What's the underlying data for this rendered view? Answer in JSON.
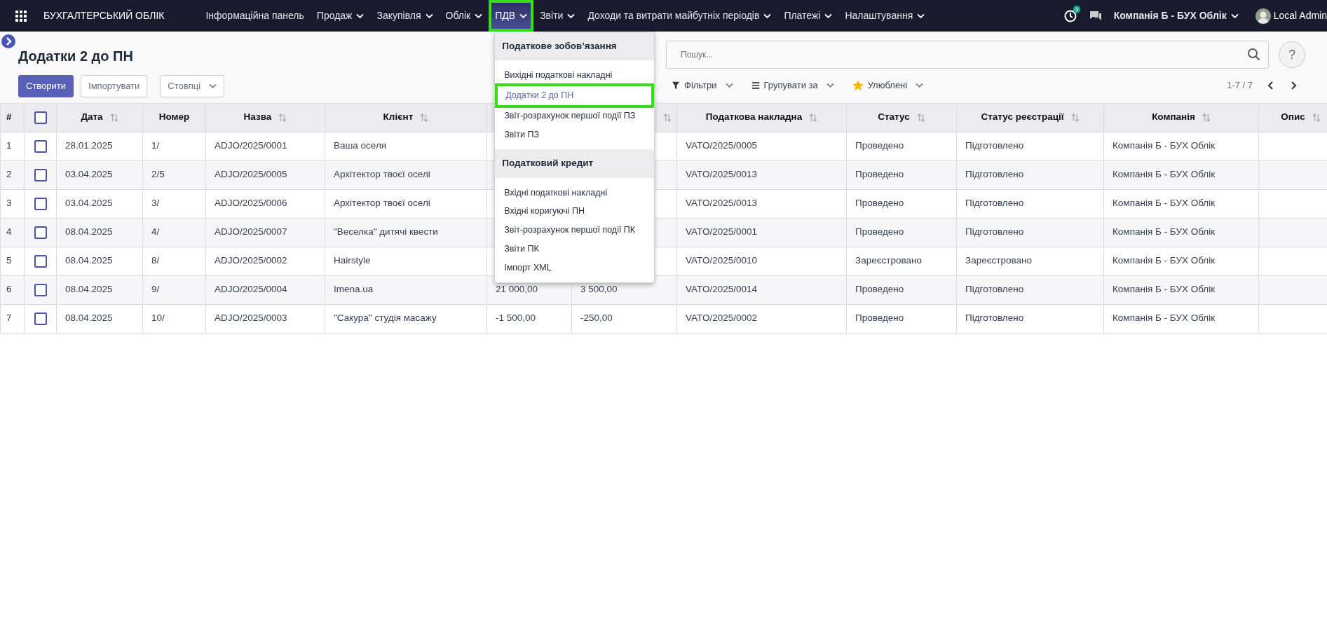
{
  "app_title": "БУХГАЛТЕРСЬКИЙ ОБЛІК",
  "nav": [
    {
      "label": "Інформаційна панель",
      "dropdown": false,
      "selected": false,
      "highlighted": false
    },
    {
      "label": "Продаж",
      "dropdown": true,
      "selected": false,
      "highlighted": false
    },
    {
      "label": "Закупівля",
      "dropdown": true,
      "selected": false,
      "highlighted": false
    },
    {
      "label": "Облік",
      "dropdown": true,
      "selected": false,
      "highlighted": false
    },
    {
      "label": "ПДВ",
      "dropdown": true,
      "selected": true,
      "highlighted": true
    },
    {
      "label": "Звіти",
      "dropdown": true,
      "selected": false,
      "highlighted": false
    },
    {
      "label": "Доходи та витрати майбутніх періодів",
      "dropdown": true,
      "selected": false,
      "highlighted": false
    },
    {
      "label": "Платежі",
      "dropdown": true,
      "selected": false,
      "highlighted": false
    },
    {
      "label": "Налаштування",
      "dropdown": true,
      "selected": false,
      "highlighted": false
    }
  ],
  "activity_count": "3",
  "company": "Компанія Б - БУХ Облік",
  "user": "Local Admin",
  "open_menu": {
    "sections": [
      {
        "title": "Податкове зобов'язання",
        "items": [
          {
            "label": "Вихідні податкові накладні",
            "selected": false,
            "highlighted": false
          },
          {
            "label": "Додатки 2 до ПН",
            "selected": true,
            "highlighted": true
          },
          {
            "label": "Звіт-розрахунок першої події ПЗ",
            "selected": false,
            "highlighted": false
          },
          {
            "label": "Звіти ПЗ",
            "selected": false,
            "highlighted": false
          }
        ]
      },
      {
        "title": "Податковий кредит",
        "items": [
          {
            "label": "Вхідні податкові накладні",
            "selected": false,
            "highlighted": false
          },
          {
            "label": "Вхідні коригуючі ПН",
            "selected": false,
            "highlighted": false
          },
          {
            "label": "Звіт-розрахунок першої події ПК",
            "selected": false,
            "highlighted": false
          },
          {
            "label": "Звіти ПК",
            "selected": false,
            "highlighted": false
          },
          {
            "label": "Імпорт XML",
            "selected": false,
            "highlighted": false
          }
        ]
      }
    ]
  },
  "page_title": "Додатки 2 до ПН",
  "buttons": {
    "create": "Створити",
    "import": "Імпортувати",
    "columns": "Стовпці"
  },
  "search": {
    "placeholder": "Пошук..."
  },
  "help": "?",
  "filters": [
    "Фільтри",
    "Групувати за",
    "Улюблені"
  ],
  "pager": "1-7 / 7",
  "table": {
    "all_selected": false,
    "columns": [
      {
        "kind": "text",
        "label": "#",
        "sortable": false
      },
      {
        "kind": "checkbox"
      },
      {
        "kind": "text",
        "label": "Дата",
        "sortable": true
      },
      {
        "kind": "text",
        "label": "Номер",
        "sortable": false
      },
      {
        "kind": "text",
        "label": "Назва",
        "sortable": true
      },
      {
        "kind": "text",
        "label": "Клієнт",
        "sortable": true
      },
      {
        "kind": "text",
        "sortable": false
      },
      {
        "kind": "text",
        "sortable": true
      },
      {
        "kind": "text",
        "label": "Податкова накладна",
        "sortable": true
      },
      {
        "kind": "text",
        "label": "Статус",
        "sortable": true
      },
      {
        "kind": "text",
        "label": "Статус реєстрації",
        "sortable": true
      },
      {
        "kind": "text",
        "label": "Компанія",
        "sortable": true
      },
      {
        "kind": "text",
        "label": "Опис",
        "sortable": true
      }
    ],
    "rows": [
      {
        "index": "1",
        "selected": false,
        "date": "28.01.2025",
        "number": "1/",
        "name": "ADJO/2025/0001",
        "client": "Ваша оселя",
        "invoice": "VATO/2025/0005",
        "status": "Проведено",
        "reg_status": "Підготовлено",
        "company": "Компанія Б - БУХ Облік"
      },
      {
        "index": "2",
        "selected": false,
        "date": "03.04.2025",
        "number": "2/5",
        "name": "ADJO/2025/0005",
        "client": "Архітектор твоєї оселі",
        "invoice": "VATO/2025/0013",
        "status": "Проведено",
        "reg_status": "Підготовлено",
        "company": "Компанія Б - БУХ Облік"
      },
      {
        "index": "3",
        "selected": false,
        "date": "03.04.2025",
        "number": "3/",
        "name": "ADJO/2025/0006",
        "client": "Архітектор твоєї оселі",
        "invoice": "VATO/2025/0013",
        "status": "Проведено",
        "reg_status": "Підготовлено",
        "company": "Компанія Б - БУХ Облік"
      },
      {
        "index": "4",
        "selected": false,
        "date": "08.04.2025",
        "number": "4/",
        "name": "ADJO/2025/0007",
        "client": "\"Веселка\" дитячі квести",
        "invoice": "VATO/2025/0001",
        "status": "Проведено",
        "reg_status": "Підготовлено",
        "company": "Компанія Б - БУХ Облік"
      },
      {
        "index": "5",
        "selected": false,
        "date": "08.04.2025",
        "number": "8/",
        "name": "ADJO/2025/0002",
        "client": "Hairstyle",
        "invoice": "VATO/2025/0010",
        "status": "Зареєстровано",
        "reg_status": "Зареєстровано",
        "company": "Компанія Б - БУХ Облік"
      },
      {
        "index": "6",
        "selected": false,
        "date": "08.04.2025",
        "number": "9/",
        "name": "ADJO/2025/0004",
        "client": "Imena.ua",
        "column_5": "21 000,00",
        "column_6": "3 500,00",
        "invoice": "VATO/2025/0014",
        "status": "Проведено",
        "reg_status": "Підготовлено",
        "company": "Компанія Б - БУХ Облік"
      },
      {
        "index": "7",
        "selected": false,
        "date": "08.04.2025",
        "number": "10/",
        "name": "ADJO/2025/0003",
        "client": "\"Сакура\" студія масажу",
        "column_5": "-1 500,00",
        "column_6": "-250,00",
        "invoice": "VATO/2025/0002",
        "status": "Проведено",
        "reg_status": "Підготовлено",
        "company": "Компанія Б - БУХ Облік"
      }
    ]
  }
}
